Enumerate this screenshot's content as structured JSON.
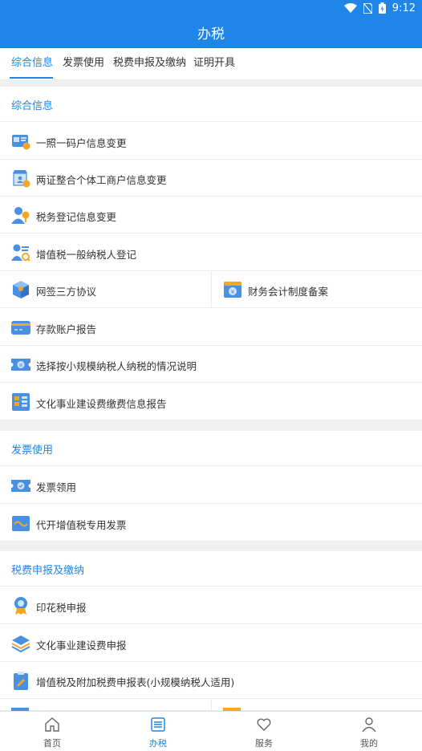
{
  "status_bar": {
    "time": "9:12"
  },
  "header": {
    "title": "办税"
  },
  "tabs": [
    {
      "label": "综合信息",
      "active": true
    },
    {
      "label": "发票使用",
      "active": false
    },
    {
      "label": "税费申报及缴纳",
      "active": false
    },
    {
      "label": "证明开具",
      "active": false
    }
  ],
  "sections": {
    "general": {
      "title": "综合信息",
      "items": [
        {
          "label": "一照一码户信息变更",
          "icon": "id-card-icon"
        },
        {
          "label": "两证整合个体工商户信息变更",
          "icon": "shop-icon"
        },
        {
          "label": "税务登记信息变更",
          "icon": "person-edit-icon"
        },
        {
          "label": "增值税一般纳税人登记",
          "icon": "person-list-icon"
        },
        {
          "label": "网签三方协议",
          "icon": "cube-icon"
        },
        {
          "label": "财务会计制度备案",
          "icon": "yuan-folder-icon"
        },
        {
          "label": "存款账户报告",
          "icon": "bank-card-icon"
        },
        {
          "label": "选择按小规模纳税人纳税的情况说明",
          "icon": "ticket-icon"
        },
        {
          "label": "文化事业建设费缴费信息报告",
          "icon": "building-icon"
        }
      ]
    },
    "invoice": {
      "title": "发票使用",
      "items": [
        {
          "label": "发票领用",
          "icon": "invoice-check-icon"
        },
        {
          "label": "代开增值税专用发票",
          "icon": "invoice-wave-icon"
        }
      ]
    },
    "declare": {
      "title": "税费申报及缴纳",
      "items": [
        {
          "label": "印花税申报",
          "icon": "stamp-medal-icon"
        },
        {
          "label": "文化事业建设费申报",
          "icon": "layers-icon"
        },
        {
          "label": "增值税及附加税费申报表(小规模纳税人适用)",
          "icon": "clipboard-icon"
        }
      ]
    }
  },
  "bottom_nav": [
    {
      "label": "首页",
      "icon": "home-icon",
      "active": false
    },
    {
      "label": "办税",
      "icon": "list-icon",
      "active": true
    },
    {
      "label": "服务",
      "icon": "heart-icon",
      "active": false
    },
    {
      "label": "我的",
      "icon": "user-icon",
      "active": false
    }
  ],
  "colors": {
    "primary": "#1f85e8",
    "accent_orange": "#f5a623"
  }
}
